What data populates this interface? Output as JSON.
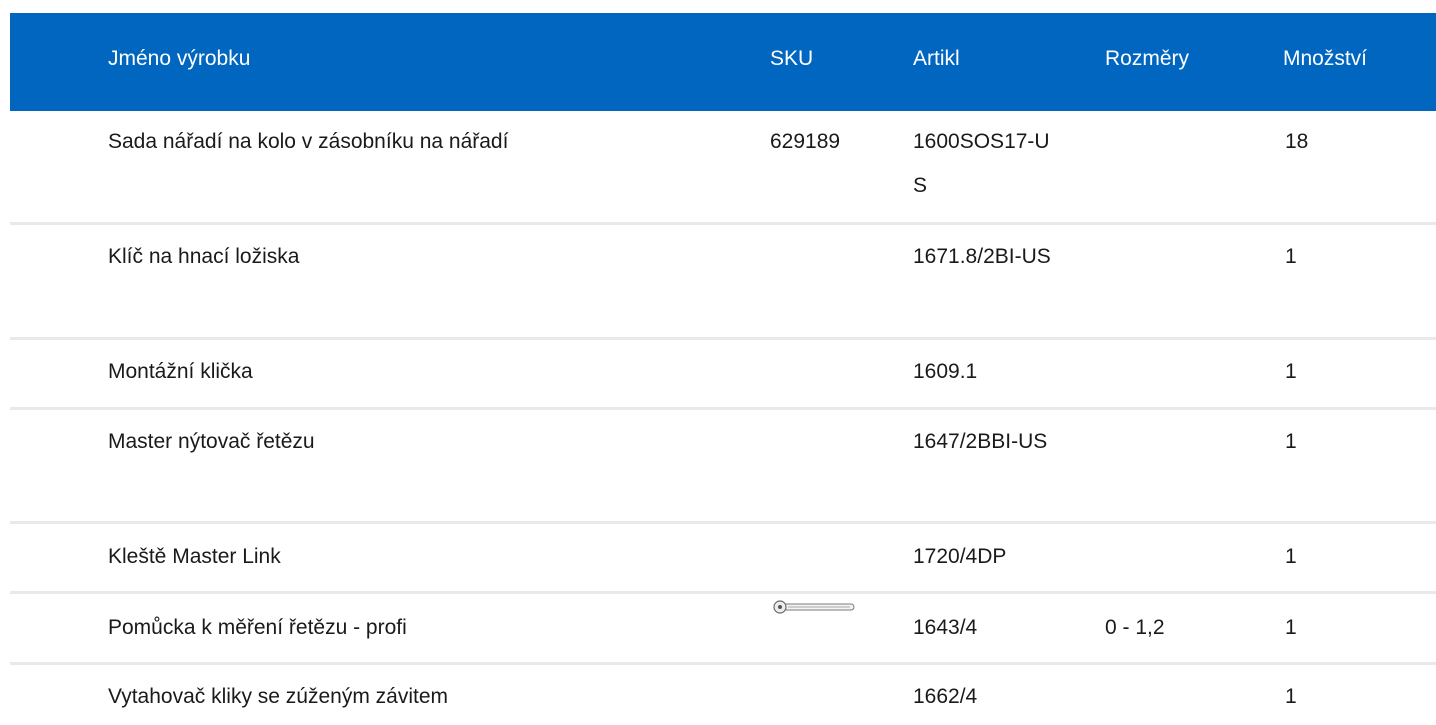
{
  "table": {
    "headers": {
      "name": "Jméno výrobku",
      "sku": "SKU",
      "article": "Artikl",
      "dimensions": "Rozměry",
      "quantity": "Množství"
    },
    "rows": [
      {
        "name": "Sada nářadí na kolo v zásobníku na nářadí",
        "sku": "629189",
        "article": "1600SOS17-US",
        "dimensions": "",
        "quantity": "18",
        "image": null
      },
      {
        "name": "Klíč na hnací ložiska",
        "sku": "",
        "article": "1671.8/2BI-US",
        "dimensions": "",
        "quantity": "1",
        "image": null
      },
      {
        "name": "Montážní klička",
        "sku": "",
        "article": "1609.1",
        "dimensions": "",
        "quantity": "1",
        "image": null
      },
      {
        "name": "Master nýtovač řetězu",
        "sku": "",
        "article": "1647/2BBI-US",
        "dimensions": "",
        "quantity": "1",
        "image": null
      },
      {
        "name": "Kleště Master Link",
        "sku": "",
        "article": "1720/4DP",
        "dimensions": "",
        "quantity": "1",
        "image": null
      },
      {
        "name": "Pomůcka k měření řetězu - profi",
        "sku": "",
        "article": "1643/4",
        "dimensions": "0 - 1,2",
        "quantity": "1",
        "image": "chain-gauge-tool-icon"
      },
      {
        "name": "Vytahovač kliky se zúženým závitem",
        "sku": "",
        "article": "1662/4",
        "dimensions": "",
        "quantity": "1",
        "image": null
      }
    ]
  },
  "colors": {
    "header_bg": "#0066bf",
    "header_text": "#ffffff",
    "row_divider": "#e9e9e9"
  }
}
